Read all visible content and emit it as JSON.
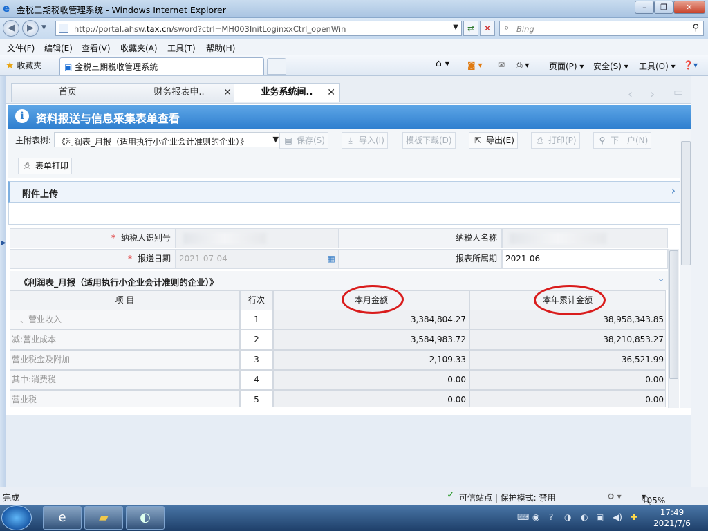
{
  "window": {
    "title": "金税三期税收管理系统 - Windows Internet Explorer",
    "url_prefix": "http://portal.ahsw.",
    "url_domain": "tax.cn",
    "url_suffix": "/sword?ctrl=MH003InitLoginxxCtrl_openWin",
    "search_placeholder": "Bing"
  },
  "menu": [
    "文件(F)",
    "编辑(E)",
    "查看(V)",
    "收藏夹(A)",
    "工具(T)",
    "帮助(H)"
  ],
  "favorites": {
    "label": "收藏夹",
    "tab_title": "金税三期税收管理系统"
  },
  "commandbar": {
    "page": "页面(P)",
    "safety": "安全(S)",
    "tools": "工具(O)"
  },
  "page_tabs": [
    {
      "label": "首页"
    },
    {
      "label": "财务报表申.."
    },
    {
      "label": "业务系统间.."
    }
  ],
  "banner": {
    "title": "资料报送与信息采集表单查看"
  },
  "toolbar": {
    "label": "主附表树:",
    "selected_form": "《利润表_月报（适用执行小企业会计准则的企业）》",
    "save": "保存(S)",
    "import": "导入(I)",
    "template": "模板下载(D)",
    "export": "导出(E)",
    "print": "打印(P)",
    "next": "下一户(N)",
    "form_print": "表单打印"
  },
  "attachment": {
    "title": "附件上传"
  },
  "info": {
    "taxpayer_id_label": "纳税人识别号",
    "taxpayer_name_label": "纳税人名称",
    "submit_date_label": "报送日期",
    "submit_date": "2021-07-04",
    "period_label": "报表所属期",
    "period": "2021-06"
  },
  "section_title": "《利润表_月报（适用执行小企业会计准则的企业）》",
  "table": {
    "headers": {
      "item": "项 目",
      "line": "行次",
      "month": "本月金额",
      "year": "本年累计金额"
    },
    "rows": [
      {
        "item": "一、营业收入",
        "line": "1",
        "month": "3,384,804.27",
        "year": "38,958,343.85"
      },
      {
        "item": "减:营业成本",
        "line": "2",
        "month": "3,584,983.72",
        "year": "38,210,853.27"
      },
      {
        "item": "营业税金及附加",
        "line": "3",
        "month": "2,109.33",
        "year": "36,521.99"
      },
      {
        "item": "其中:消费税",
        "line": "4",
        "month": "0.00",
        "year": "0.00"
      },
      {
        "item": "营业税",
        "line": "5",
        "month": "0.00",
        "year": "0.00"
      }
    ]
  },
  "status": {
    "left": "完成",
    "zone": "可信站点 | 保护模式: 禁用",
    "zoom": "105%"
  },
  "clock": {
    "time": "17:49",
    "date": "2021/7/6"
  },
  "colors": {
    "banner": "#3a8ad6",
    "required": "#dd2222",
    "annotation": "#d91c1c"
  }
}
